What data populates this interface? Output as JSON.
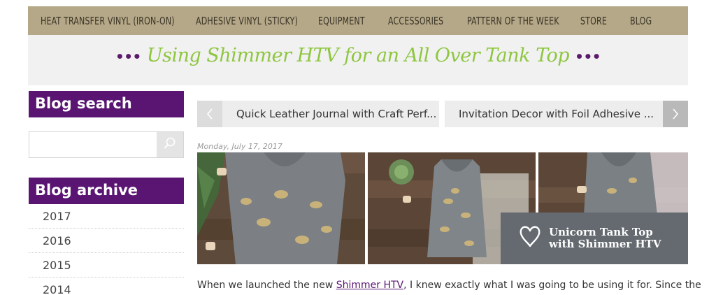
{
  "nav": {
    "items": [
      {
        "label": "HEAT TRANSFER VINYL (IRON-ON)"
      },
      {
        "label": "ADHESIVE VINYL (STICKY)"
      },
      {
        "label": "EQUIPMENT"
      },
      {
        "label": "ACCESSORIES"
      },
      {
        "label": "PATTERN OF THE WEEK"
      },
      {
        "label": "STORE"
      },
      {
        "label": "BLOG"
      }
    ]
  },
  "header": {
    "title": "Using Shimmer HTV for an All Over Tank Top",
    "dots_left": "•••",
    "dots_right": "•••"
  },
  "sidebar": {
    "search_heading": "Blog search",
    "search_value": "",
    "archive_heading": "Blog archive",
    "archive_years": [
      {
        "label": "2017"
      },
      {
        "label": "2016"
      },
      {
        "label": "2015"
      },
      {
        "label": "2014"
      }
    ]
  },
  "post_nav": {
    "prev_title": "Quick Leather Journal with Craft Perf...",
    "next_title": "Invitation Decor with Foil Adhesive ..."
  },
  "post": {
    "date": "Monday, July 17, 2017",
    "caption_line1": "Unicorn Tank Top",
    "caption_line2": "with Shimmer HTV",
    "body_before_link": "When we launched the new ",
    "body_link": "Shimmer HTV",
    "body_after_link": ", I knew exactly what I was going to be using it for. Since the"
  },
  "colors": {
    "nav_bg": "#b5a888",
    "accent_purple": "#5a1573",
    "title_green": "#8ec63f"
  }
}
